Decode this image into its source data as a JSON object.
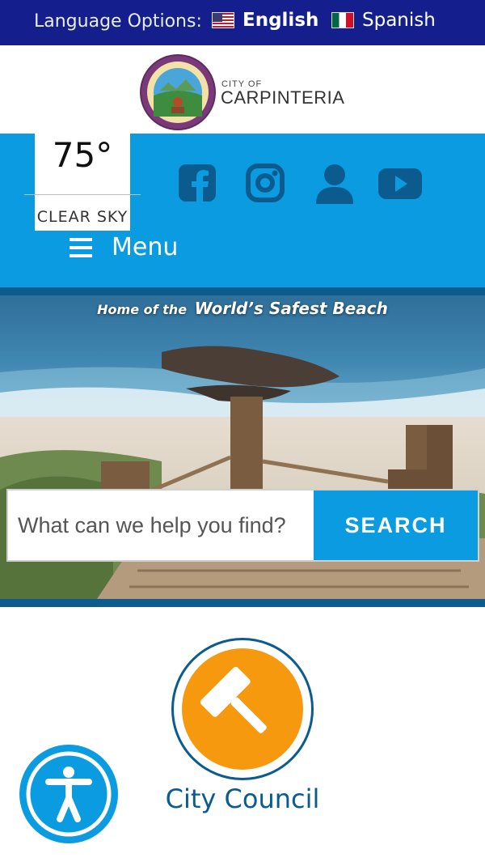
{
  "language_bar": {
    "label": "Language Options:",
    "options": [
      {
        "label": "English",
        "flag": "us-flag-icon",
        "selected": true
      },
      {
        "label": "Spanish",
        "flag": "mx-flag-icon",
        "selected": false
      }
    ]
  },
  "brand": {
    "small": "CITY OF",
    "name": "CARPINTERIA",
    "seal_icon": "city-seal-icon"
  },
  "weather": {
    "temperature": "75°",
    "condition": "CLEAR SKY"
  },
  "social": [
    {
      "name": "facebook-icon"
    },
    {
      "name": "instagram-icon"
    },
    {
      "name": "user-icon"
    },
    {
      "name": "youtube-icon"
    }
  ],
  "menu": {
    "label": "Menu"
  },
  "hero": {
    "tagline_small": "Home of the",
    "tagline_big": "World’s Safest Beach"
  },
  "search": {
    "placeholder": "What can we help you find?",
    "button_label": "SEARCH"
  },
  "quick_links": [
    {
      "label": "City Council",
      "icon": "gavel-icon",
      "color": "#f6990e"
    }
  ],
  "accessibility": {
    "icon": "accessibility-icon"
  },
  "colors": {
    "lang_bar": "#141e8c",
    "primary_blue": "#0a9be0",
    "dark_blue": "#0b5b8e",
    "orange": "#f6990e"
  }
}
